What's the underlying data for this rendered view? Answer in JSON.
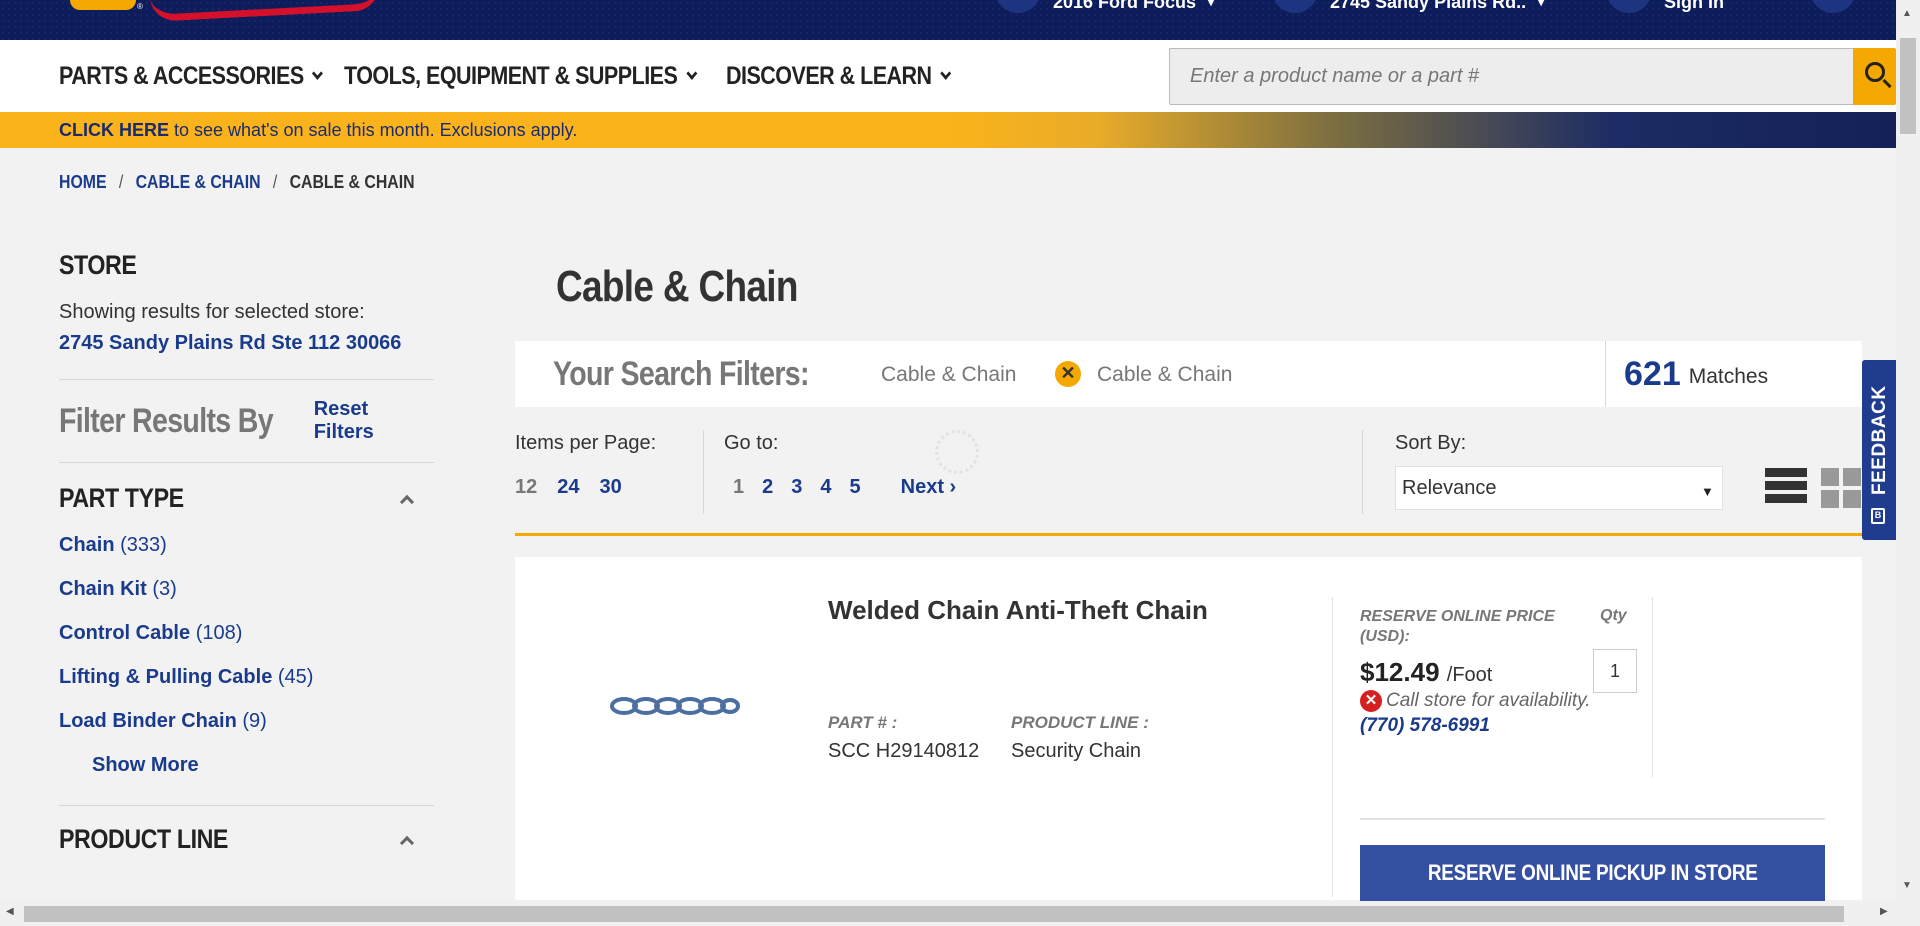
{
  "header": {
    "vehicle": "2016 Ford Focus",
    "store": "2745 Sandy Plains Rd..",
    "sign_in": "Sign In"
  },
  "nav": {
    "items": [
      {
        "label": "PARTS & ACCESSORIES"
      },
      {
        "label": "TOOLS, EQUIPMENT & SUPPLIES"
      },
      {
        "label": "DISCOVER & LEARN"
      }
    ],
    "search_placeholder": "Enter a product name or a part #"
  },
  "promo": {
    "link": "CLICK HERE",
    "text": " to see what's on sale this month. Exclusions apply."
  },
  "breadcrumb": [
    "HOME",
    "CABLE & CHAIN",
    "CABLE & CHAIN"
  ],
  "sidebar": {
    "store_heading": "STORE",
    "store_text": "Showing results for selected store:",
    "store_address": "2745 Sandy Plains Rd Ste 112 30066",
    "filter_title": "Filter Results By",
    "reset_label": "Reset Filters",
    "part_type_heading": "PART TYPE",
    "part_types": [
      {
        "name": "Chain",
        "count": "(333)"
      },
      {
        "name": "Chain Kit",
        "count": "(3)"
      },
      {
        "name": "Control Cable",
        "count": "(108)"
      },
      {
        "name": "Lifting & Pulling Cable",
        "count": "(45)"
      },
      {
        "name": "Load Binder Chain",
        "count": "(9)"
      }
    ],
    "show_more": "Show More",
    "product_line_heading": "PRODUCT LINE"
  },
  "main": {
    "title": "Cable & Chain",
    "filters_label": "Your Search Filters:",
    "filter_chips": [
      "Cable & Chain",
      "Cable & Chain"
    ],
    "matches_count": "621",
    "matches_label": "Matches",
    "items_per_page_label": "Items per Page:",
    "items_per_page": [
      "12",
      "24",
      "30"
    ],
    "goto_label": "Go to:",
    "pages": [
      "1",
      "2",
      "3",
      "4",
      "5"
    ],
    "next_label": "Next",
    "sort_label": "Sort By:",
    "sort_value": "Relevance"
  },
  "feedback_label": "FEEDBACK",
  "product": {
    "title": "Welded Chain Anti-Theft Chain",
    "part_label": "PART # :",
    "part_value": "SCC H29140812",
    "line_label": "PRODUCT LINE :",
    "line_value": "Security Chain",
    "price_label": "RESERVE ONLINE PRICE (USD):",
    "qty_label": "Qty",
    "price": "$12.49",
    "unit": "/Foot",
    "qty_value": "1",
    "availability": "Call store for availability.",
    "phone": "(770) 578-6991",
    "reserve_button": "RESERVE ONLINE PICKUP IN STORE"
  }
}
